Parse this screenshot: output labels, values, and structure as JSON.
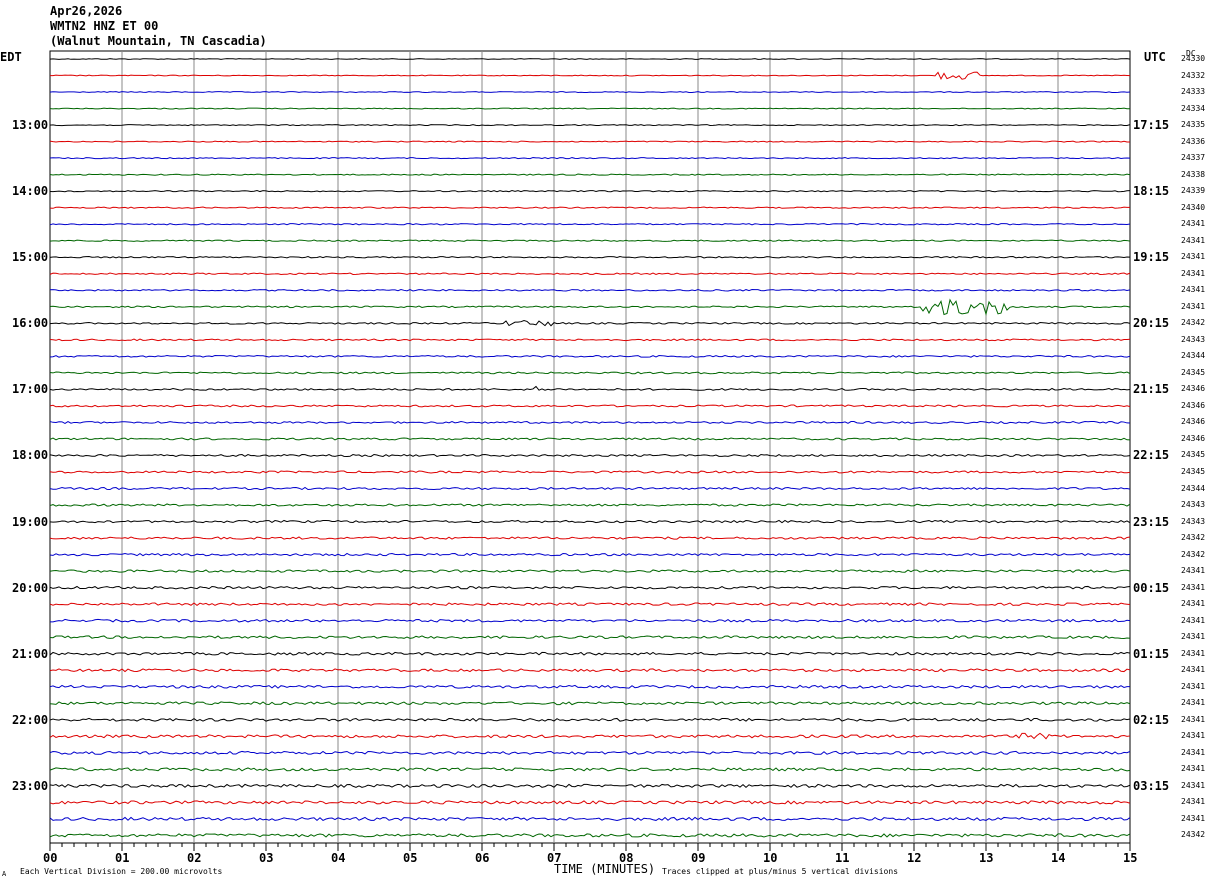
{
  "header": {
    "date": "Apr26,2026",
    "station": "WMTN2 HNZ ET 00",
    "location": "(Walnut Mountain, TN Cascadia)"
  },
  "left_tz": "EDT",
  "right_tz": "UTC",
  "dc_label": "DC",
  "footer": {
    "scale_note": "Each Vertical Division =  200.00 microvolts",
    "xlabel": "TIME (MINUTES)",
    "clip_note": "Traces clipped at plus/minus 5 vertical divisions",
    "corner_mark": "A"
  },
  "colors": {
    "black": "#000000",
    "red": "#dd0000",
    "blue": "#0000cc",
    "green": "#006600",
    "grid": "#888888"
  },
  "chart_data": {
    "type": "line",
    "title": "WMTN2 HNZ ET 00",
    "xlabel": "TIME (MINUTES)",
    "xlim": [
      0,
      15
    ],
    "x_ticks": [
      "00",
      "01",
      "02",
      "03",
      "04",
      "05",
      "06",
      "07",
      "08",
      "09",
      "10",
      "11",
      "12",
      "13",
      "14",
      "15"
    ],
    "series_colors_cycle": [
      "black",
      "red",
      "blue",
      "green"
    ],
    "left_hour_labels": [
      "13:00",
      "14:00",
      "15:00",
      "16:00",
      "17:00",
      "18:00",
      "19:00",
      "20:00",
      "21:00",
      "22:00",
      "23:00"
    ],
    "right_hour_labels": [
      "17:15",
      "18:15",
      "19:15",
      "20:15",
      "21:15",
      "22:15",
      "23:15",
      "00:15",
      "01:15",
      "02:15",
      "03:15"
    ],
    "hour_label_first_trace": 4,
    "traces_per_hour": 4,
    "trace_count": 48,
    "dc_offsets": [
      "24330",
      "24332",
      "24333",
      "24334",
      "24335",
      "24336",
      "24337",
      "24338",
      "24339",
      "24340",
      "24341",
      "24341",
      "24341",
      "24341",
      "24341",
      "24341",
      "24342",
      "24343",
      "24344",
      "24345",
      "24346",
      "24346",
      "24346",
      "24346",
      "24345",
      "24345",
      "24344",
      "24343",
      "24343",
      "24342",
      "24342",
      "24341",
      "24341",
      "24341",
      "24341",
      "24341",
      "24341",
      "24341",
      "24341",
      "24341",
      "24341",
      "24341",
      "24341",
      "24341",
      "24341",
      "24341",
      "24341",
      "24342"
    ],
    "events": [
      {
        "trace": 1,
        "minute_start": 12.3,
        "minute_end": 12.9,
        "amplitude": "medium"
      },
      {
        "trace": 15,
        "minute_start": 12.1,
        "minute_end": 13.3,
        "amplitude": "large"
      },
      {
        "trace": 16,
        "minute_start": 6.3,
        "minute_end": 7.0,
        "amplitude": "small"
      },
      {
        "trace": 20,
        "minute_start": 6.6,
        "minute_end": 6.9,
        "amplitude": "small"
      },
      {
        "trace": 41,
        "minute_start": 13.4,
        "minute_end": 13.9,
        "amplitude": "small"
      }
    ],
    "vertical_division_microvolts": 200.0
  }
}
